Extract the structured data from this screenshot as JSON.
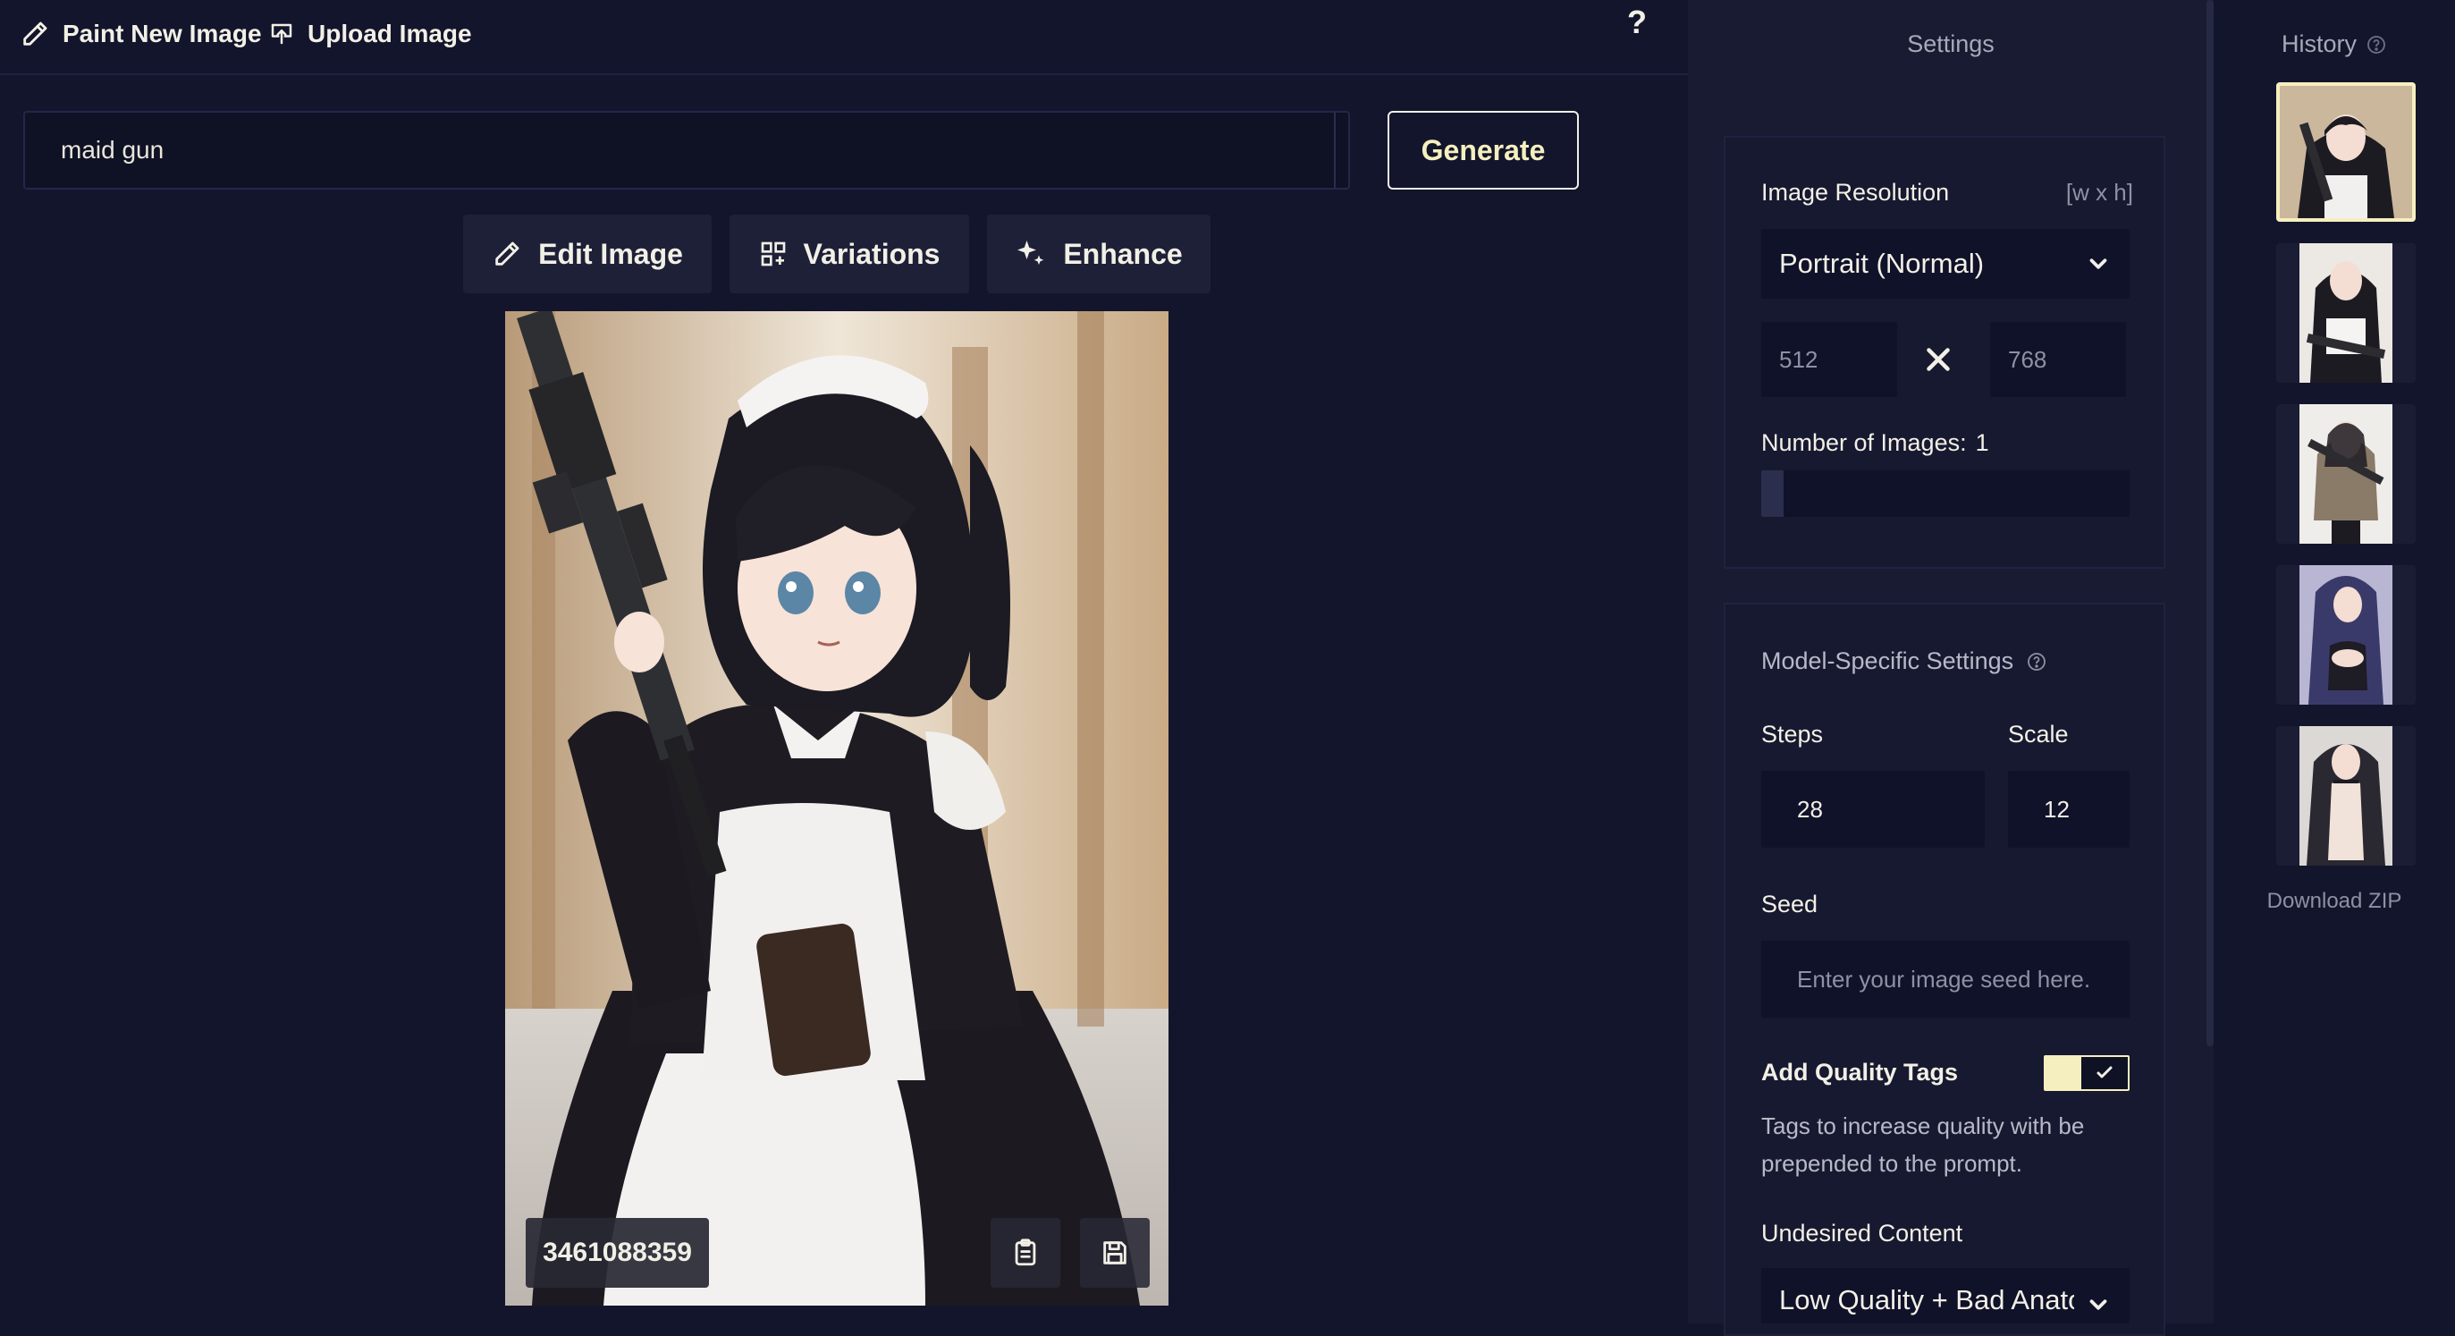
{
  "topbar": {
    "paint_new": "Paint New Image",
    "upload": "Upload Image",
    "help": "?"
  },
  "prompt": {
    "value": "maid gun",
    "generate_label": "Generate"
  },
  "tools": {
    "edit": "Edit Image",
    "variations": "Variations",
    "enhance": "Enhance"
  },
  "image": {
    "seed": "3461088359"
  },
  "settings": {
    "title": "Settings",
    "resolution_label": "Image Resolution",
    "resolution_hint": "[w x h]",
    "resolution_value": "Portrait (Normal)",
    "width": "512",
    "height": "768",
    "num_images_label": "Number of Images:",
    "num_images_value": "1",
    "num_images_fraction": 0.06,
    "model_specific_label": "Model-Specific Settings",
    "steps_label": "Steps",
    "steps_value": "28",
    "scale_label": "Scale",
    "scale_value": "12",
    "seed_label": "Seed",
    "seed_placeholder": "Enter your image seed here.",
    "quality_tags_label": "Add Quality Tags",
    "quality_tags_on": true,
    "quality_tags_desc_1": "Tags to increase quality with be",
    "quality_tags_desc_2": "prepended to the prompt.",
    "undesired_label": "Undesired Content",
    "undesired_value": "Low Quality + Bad Anato"
  },
  "history": {
    "title": "History",
    "download_zip": "Download ZIP"
  },
  "colors": {
    "background": "#13152c",
    "panel": "#191b33",
    "accent": "#f5efbf",
    "text": "#f2f0e6",
    "muted": "#a8a9b8"
  }
}
